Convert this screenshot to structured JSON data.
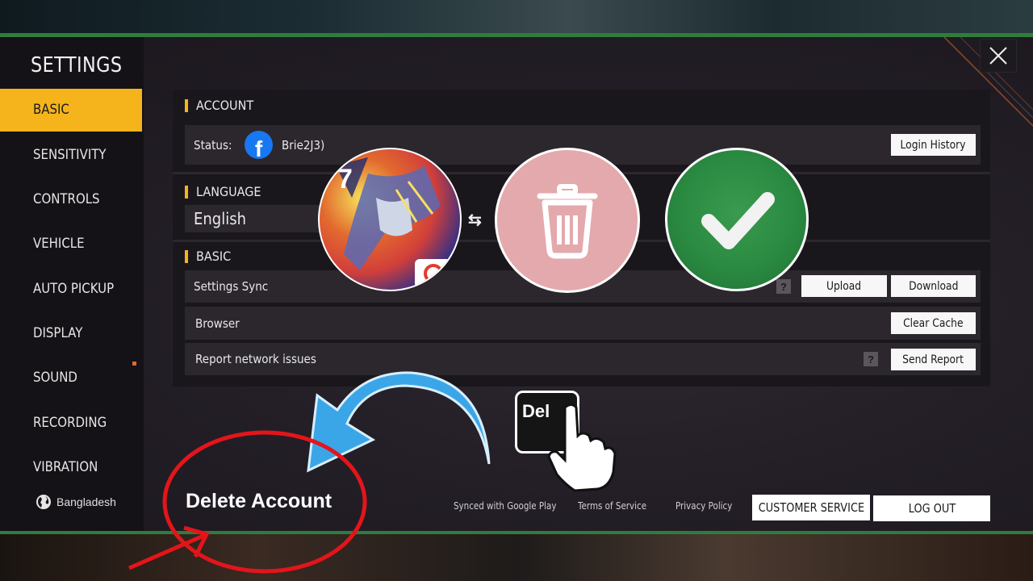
{
  "window": {
    "title": "SETTINGS"
  },
  "sidebar": {
    "items": [
      {
        "label": "BASIC",
        "active": true
      },
      {
        "label": "SENSITIVITY"
      },
      {
        "label": "CONTROLS"
      },
      {
        "label": "VEHICLE"
      },
      {
        "label": "AUTO PICKUP"
      },
      {
        "label": "DISPLAY"
      },
      {
        "label": "SOUND"
      },
      {
        "label": "RECORDING"
      },
      {
        "label": "VIBRATION"
      }
    ],
    "region": "Bangladesh"
  },
  "account": {
    "section_title": "ACCOUNT",
    "status_label": "Status:",
    "username": "Brie2J3)",
    "login_history_button": "Login History",
    "provider_icon": "facebook-icon"
  },
  "language": {
    "section_title": "LANGUAGE",
    "selected": "English"
  },
  "basic": {
    "section_title": "BASIC",
    "settings_sync_label": "Settings Sync",
    "upload_button": "Upload",
    "download_button": "Download",
    "browser_label": "Browser",
    "clear_cache_button": "Clear Cache",
    "report_label": "Report network issues",
    "send_report_button": "Send Report",
    "help_icon": "?"
  },
  "footer": {
    "synced_link": "Synced with Google Play",
    "terms_link": "Terms of Service",
    "privacy_link": "Privacy Policy",
    "customer_service_button": "CUSTOMER SERVICE",
    "logout_button": "LOG OUT"
  },
  "overlay": {
    "delete_account_text": "Delete Account",
    "del_key_label": "Del",
    "accent_red": "#e3151a",
    "accent_blue": "#3aa6e8",
    "check_green": "#2a8a41",
    "trash_pink": "#e3a9ac"
  },
  "colors": {
    "active_tab": "#f5b41c",
    "frame_line": "#2f7d3c"
  }
}
